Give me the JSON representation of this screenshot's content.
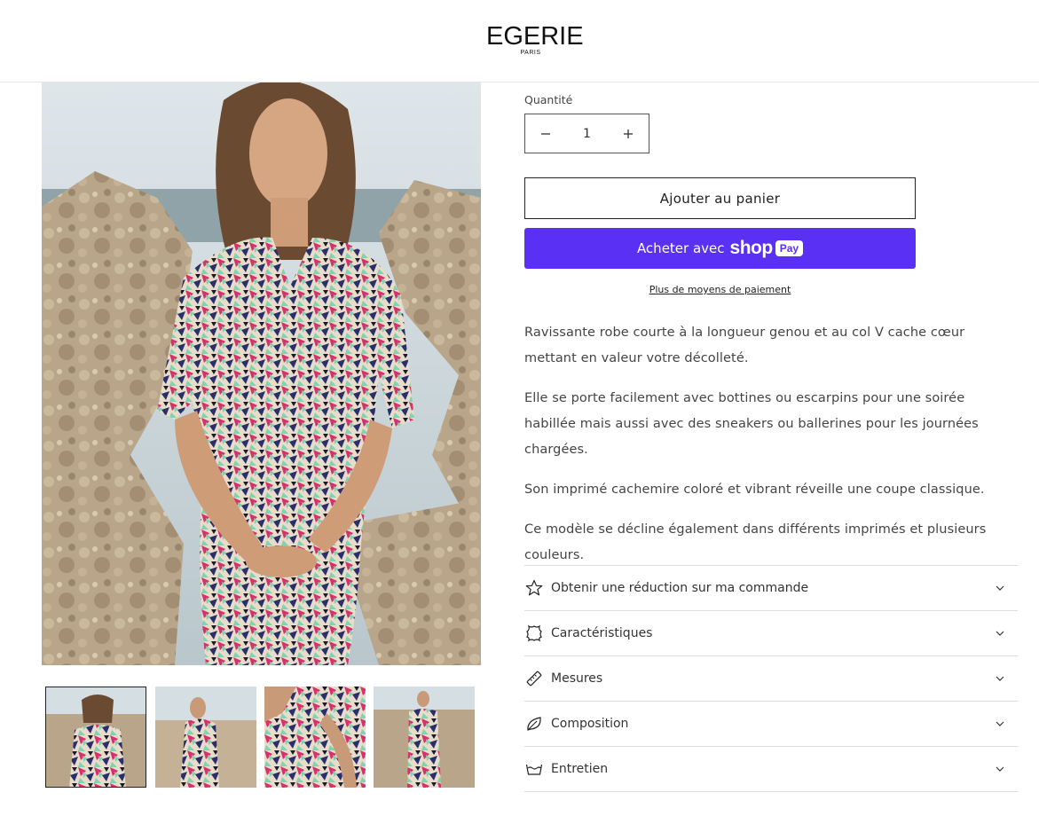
{
  "header": {
    "logo_main": "EGERIE",
    "logo_sub": "PARIS"
  },
  "product": {
    "quantity_label": "Quantité",
    "quantity_value": "1",
    "add_to_cart": "Ajouter au panier",
    "buy_with": "Acheter avec",
    "shop_brand": "shop",
    "shop_pay": "Pay",
    "more_payment": "Plus de moyens de paiement",
    "description": [
      "Ravissante robe courte à la longueur genou et au col V cache cœur mettant en valeur votre décolleté.",
      "Elle se porte facilement avec bottines ou escarpins pour une soirée habillée mais aussi avec des sneakers ou ballerines pour les journées chargées.",
      "Son imprimé cachemire coloré et vibrant réveille une coupe classique.",
      "Ce modèle se décline également dans différents imprimés et plusieurs couleurs."
    ]
  },
  "accordion": [
    {
      "label": "Obtenir une réduction sur ma commande",
      "icon": "star-icon"
    },
    {
      "label": "Caractéristiques",
      "icon": "leather-icon"
    },
    {
      "label": "Mesures",
      "icon": "ruler-icon"
    },
    {
      "label": "Composition",
      "icon": "leaf-icon"
    },
    {
      "label": "Entretien",
      "icon": "washing-icon"
    }
  ],
  "gallery": {
    "thumbnail_count": 4,
    "active_thumbnail": 1
  },
  "colors": {
    "shop_pay": "#5a31f4",
    "border": "#dddddd",
    "text": "#444444"
  }
}
